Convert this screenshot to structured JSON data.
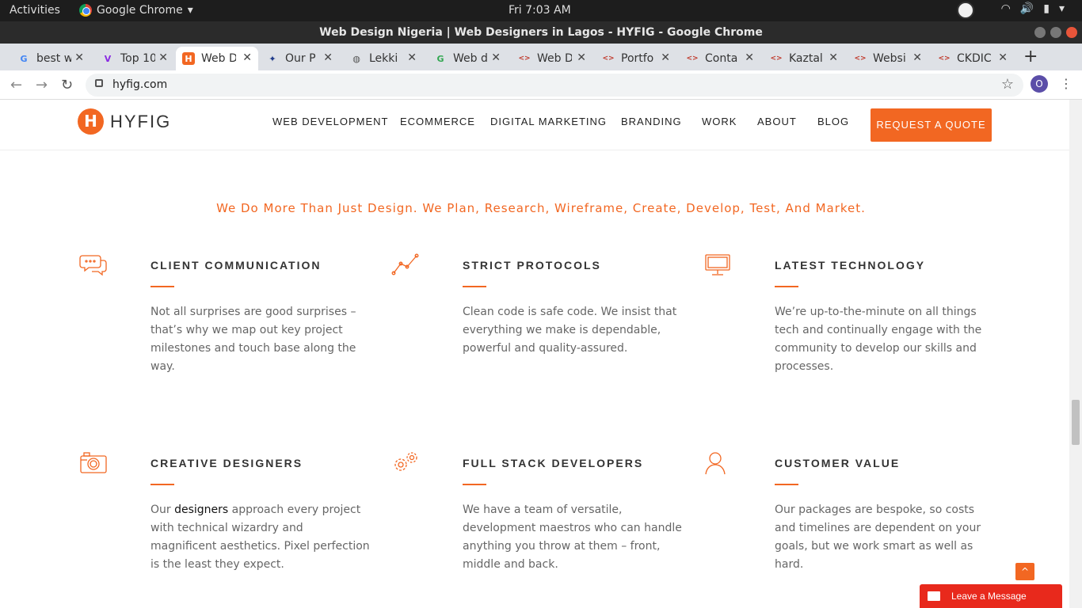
{
  "system": {
    "activities": "Activities",
    "app_name": "Google Chrome",
    "clock": "Fri  7:03 AM"
  },
  "window": {
    "title": "Web Design Nigeria | Web Designers in Lagos - HYFIG - Google Chrome"
  },
  "tabs": [
    {
      "label": "best w",
      "favicon": "G"
    },
    {
      "label": "Top 10",
      "favicon": "V"
    },
    {
      "label": "Web D",
      "favicon": "H"
    },
    {
      "label": "Our P",
      "favicon": "✦"
    },
    {
      "label": "Lekki",
      "favicon": "◍"
    },
    {
      "label": "Web d",
      "favicon": "G"
    },
    {
      "label": "Web D",
      "favicon": "<>"
    },
    {
      "label": "Portfo",
      "favicon": "<>"
    },
    {
      "label": "Conta",
      "favicon": "<>"
    },
    {
      "label": "Kaztal",
      "favicon": "<>"
    },
    {
      "label": "Websi",
      "favicon": "<>"
    },
    {
      "label": "CKDIC",
      "favicon": "<>"
    }
  ],
  "omnibox": {
    "url": "hyfig.com",
    "avatar": "O"
  },
  "site": {
    "logo": "HYFIG",
    "logo_mark": "H",
    "nav": [
      "WEB DEVELOPMENT",
      "ECOMMERCE",
      "DIGITAL MARKETING",
      "BRANDING",
      "WORK",
      "ABOUT",
      "BLOG"
    ],
    "cta": "REQUEST A QUOTE",
    "tagline": "We Do More Than Just Design. We Plan, Research, Wireframe, Create, Develop, Test, And Market.",
    "features": [
      {
        "icon": "chat-bubbles-icon",
        "title": "CLIENT COMMUNICATION",
        "text": "Not all surprises are good surprises – that’s why we map out key project milestones and touch base along the way."
      },
      {
        "icon": "line-chart-icon",
        "title": "STRICT PROTOCOLS",
        "text": "Clean code is safe code. We insist that everything we make is dependable, powerful and quality-assured."
      },
      {
        "icon": "monitor-icon",
        "title": "LATEST TECHNOLOGY",
        "text": "We’re up-to-the-minute on all things tech and continually engage with the community to develop our skills and processes."
      },
      {
        "icon": "camera-icon",
        "title": "CREATIVE DESIGNERS",
        "text_pre": "Our ",
        "text_link": "designers",
        "text_post": " approach every project with technical wizardry and magnificent aesthetics. Pixel perfection is the least they expect."
      },
      {
        "icon": "gears-icon",
        "title": "FULL STACK DEVELOPERS",
        "text": "We have a team of versatile, development maestros who can handle anything you throw at them – front, middle and back."
      },
      {
        "icon": "person-icon",
        "title": "CUSTOMER VALUE",
        "text": "Our packages are bespoke, so costs and timelines are dependent on your goals, but we work smart as well as hard."
      }
    ],
    "chat": "Leave a Message",
    "to_top": "^"
  },
  "colors": {
    "accent": "#f26722",
    "chat": "#e8291c"
  }
}
